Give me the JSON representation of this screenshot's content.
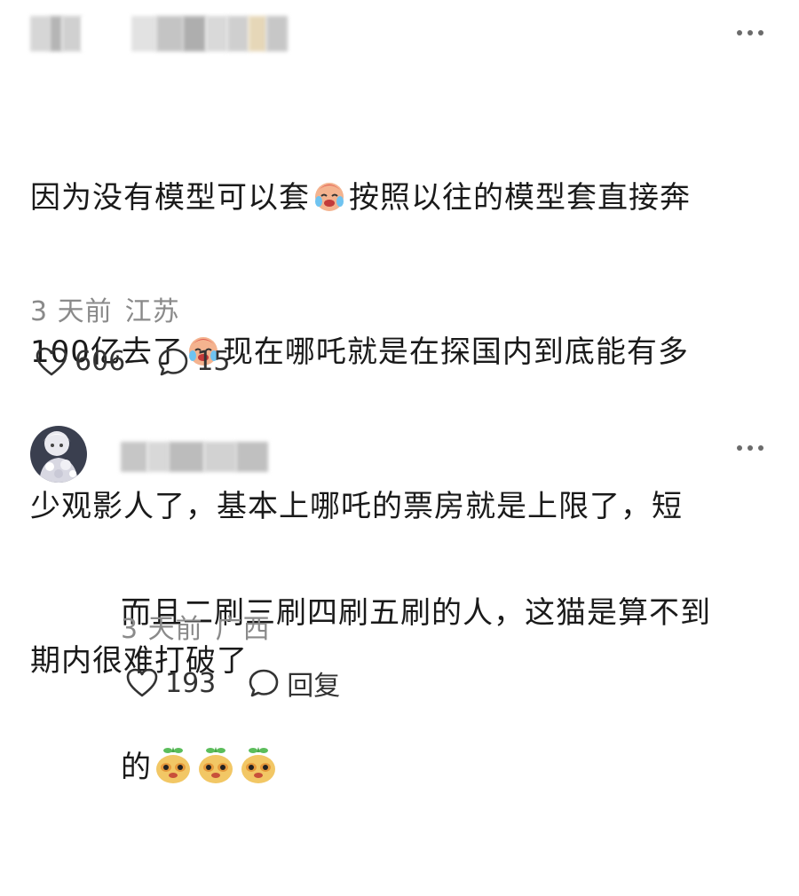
{
  "comments": [
    {
      "username": "",
      "body_lines": [
        [
          "因为没有模型可以套",
          "cry-laugh-emoji",
          "按照以往的模型套直接奔"
        ],
        [
          "100亿去了",
          "cry-laugh-emoji",
          "现在哪吒就是在探国内到底能有多"
        ],
        [
          "少观影人了，基本上哪吒的票房就是上限了，短"
        ],
        [
          "期内很难打破了"
        ]
      ],
      "time": "3 天前",
      "location": "江苏",
      "like_count": "606",
      "comment_count": "15",
      "more_icon": "more-dots-icon"
    },
    {
      "username": "",
      "body_lines": [
        [
          "而且二刷三刷四刷五刷的人，这猫是算不到"
        ],
        [
          "的",
          "mask-emoji",
          "mask-emoji",
          "mask-emoji"
        ]
      ],
      "time": "3 天前",
      "location": "广西",
      "like_count": "193",
      "reply_label": "回复",
      "more_icon": "more-dots-icon"
    }
  ],
  "colors": {
    "text": "#1a1a1a",
    "meta": "#8a8a8a",
    "icon": "#333333"
  }
}
